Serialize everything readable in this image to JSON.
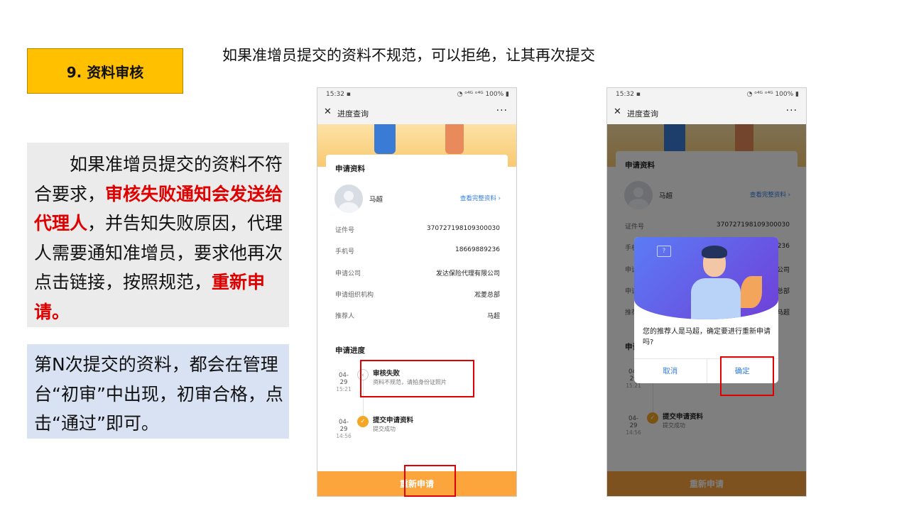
{
  "slide": {
    "title": "9. 资料审核",
    "headline": "如果准增员提交的资料不规范，可以拒绝，让其再次提交",
    "note1": {
      "p1": "如果准增员提交的资料不符合要求，",
      "p2_red": "审核失败通知会发送给代理人",
      "p3": "，并告知失败原因，代理人需要通知准增员，要求他再次点击链接，按照规范，",
      "p4_red": "重新申请。"
    },
    "note2": "第N次提交的资料，都会在管理台“初审”中出现，初审合格，点击“通过”即可。"
  },
  "phone": {
    "status_time": "15:32 ▪",
    "status_right": "◔ ᵒ⁴ᴳ ᵒ⁴ᴳ 100% ▮",
    "nav_close": "✕",
    "nav_title": "进度查询",
    "nav_more": "···",
    "section_info": "申请资料",
    "applicant_name": "马超",
    "view_full_link": "查看完整资料 ›",
    "fields": [
      {
        "label": "证件号",
        "value": "370727198109300030"
      },
      {
        "label": "手机号",
        "value": "18669889236"
      },
      {
        "label": "申请公司",
        "value": "发达保险代理有限公司"
      },
      {
        "label": "申请组织机构",
        "value": "凇菱总部"
      },
      {
        "label": "推荐人",
        "value": "马超"
      }
    ],
    "section_progress": "申请进度",
    "timeline": [
      {
        "date": "04-29",
        "time": "15:21",
        "title": "审核失败",
        "subtitle": "资料不规范，请拍身份证照片"
      },
      {
        "date": "04-29",
        "time": "14:56",
        "title": "提交申请资料",
        "subtitle": "提交成功"
      }
    ],
    "bottom_button": "重新申请"
  },
  "dialog": {
    "message": "您的推荐人是马超，确定要进行重新申请吗?",
    "cancel": "取消",
    "confirm": "确定"
  },
  "colors": {
    "title_box": "#ffc000",
    "note1_bg": "#ebebeb",
    "note2_bg": "#d9e2f3",
    "highlight_red": "#e00000",
    "button_orange": "#fba53c",
    "link_blue": "#2f7de1"
  }
}
